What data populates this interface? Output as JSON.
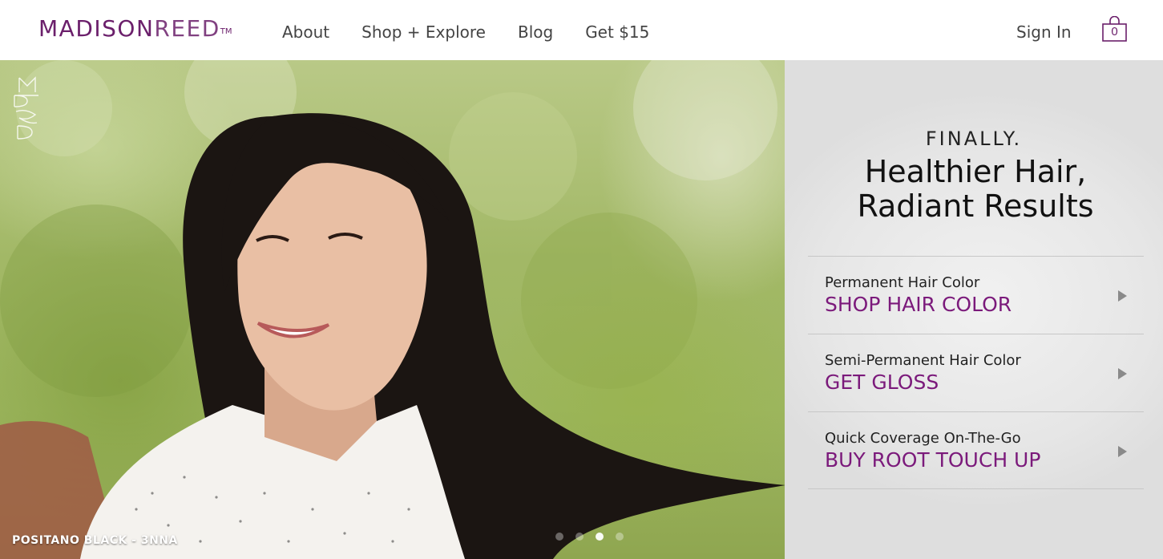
{
  "header": {
    "logo_main": "MADISON",
    "logo_second": "REED",
    "logo_tm": "TM",
    "nav": [
      {
        "label": "About"
      },
      {
        "label": "Shop + Explore"
      },
      {
        "label": "Blog"
      },
      {
        "label": "Get $15"
      }
    ],
    "sign_in": "Sign In",
    "cart_count": "0"
  },
  "hero": {
    "caption": "POSITANO BLACK - 3NNA",
    "carousel_total": 4,
    "carousel_active": 3
  },
  "panel": {
    "kicker": "FINALLY.",
    "headline_line1": "Healthier Hair,",
    "headline_line2": "Radiant Results",
    "offers": [
      {
        "subtitle": "Permanent Hair Color",
        "cta": "SHOP HAIR COLOR"
      },
      {
        "subtitle": "Semi-Permanent Hair Color",
        "cta": "GET GLOSS"
      },
      {
        "subtitle": "Quick Coverage On-The-Go",
        "cta": "BUY ROOT TOUCH UP"
      }
    ]
  },
  "colors": {
    "brand_purple": "#6b1f6b",
    "cta_purple": "#7b1a7b",
    "nav_text": "#444444",
    "panel_bg": "#e8e8e8"
  },
  "icons": {
    "cart": "shopping-bag-icon",
    "offer_arrow": "play-arrow-icon",
    "hero_mark": "mr-monogram-icon"
  }
}
